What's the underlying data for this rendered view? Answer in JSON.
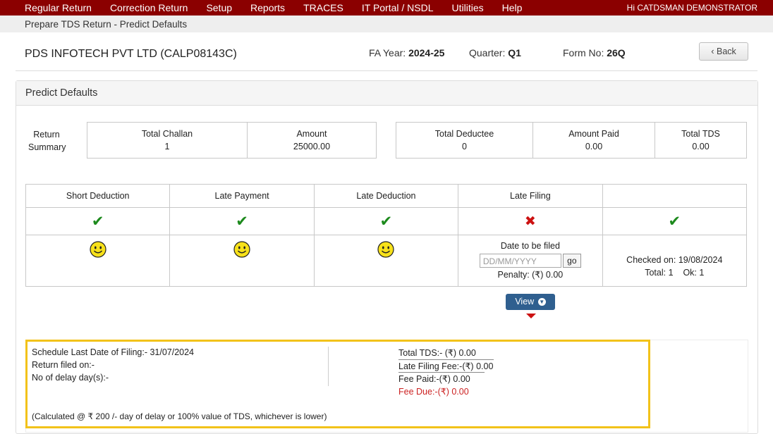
{
  "topnav": {
    "menu": [
      "Regular Return",
      "Correction Return",
      "Setup",
      "Reports",
      "TRACES",
      "IT Portal / NSDL",
      "Utilities",
      "Help"
    ],
    "greeting": "Hi CATDSMAN DEMONSTRATOR"
  },
  "breadcrumb": "Prepare TDS Return - Predict Defaults",
  "header": {
    "company": "PDS INFOTECH PVT LTD (CALP08143C)",
    "fa_year_label": "FA Year:",
    "fa_year": "2024-25",
    "quarter_label": "Quarter:",
    "quarter": "Q1",
    "form_label": "Form No:",
    "form_no": "26Q",
    "back_label": "Back"
  },
  "panel": {
    "title": "Predict Defaults"
  },
  "summary": {
    "label_line1": "Return",
    "label_line2": "Summary",
    "left": [
      {
        "label": "Total Challan",
        "value": "1"
      },
      {
        "label": "Amount",
        "value": "25000.00"
      }
    ],
    "right": [
      {
        "label": "Total Deductee",
        "value": "0"
      },
      {
        "label": "Amount Paid",
        "value": "0.00"
      },
      {
        "label": "Total TDS",
        "value": "0.00"
      }
    ]
  },
  "defaults": {
    "columns": [
      "Short Deduction",
      "Late Payment",
      "Late Deduction",
      "Late Filing",
      ""
    ],
    "status": [
      "ok",
      "ok",
      "ok",
      "fail",
      "ok"
    ],
    "date_label": "Date to be filed",
    "date_placeholder": "DD/MM/YYYY",
    "go_label": "go",
    "penalty": "Penalty: (₹) 0.00",
    "checked_on": "Checked on: 19/08/2024",
    "total": "Total: 1",
    "ok": "Ok: 1"
  },
  "view_label": "View",
  "filing": {
    "schedule": "Schedule Last Date of Filing:- 31/07/2024",
    "return_filed": "Return filed on:-",
    "delay_days": "No of delay day(s):-",
    "total_tds": "Total TDS:- (₹) 0.00",
    "late_fee": "Late Filing Fee:-(₹) 0.00",
    "fee_paid": "Fee Paid:-(₹) 0.00",
    "fee_due": "Fee Due:-(₹) 0.00",
    "note": "(Calculated @ ₹ 200 /- day of delay or 100% value of TDS, whichever is lower)"
  },
  "colors": {
    "nav": "#8b0000",
    "tick": "#1d8a1d",
    "cross": "#cc1111",
    "highlight": "#f2c21a",
    "view_button": "#2f5f8f"
  }
}
